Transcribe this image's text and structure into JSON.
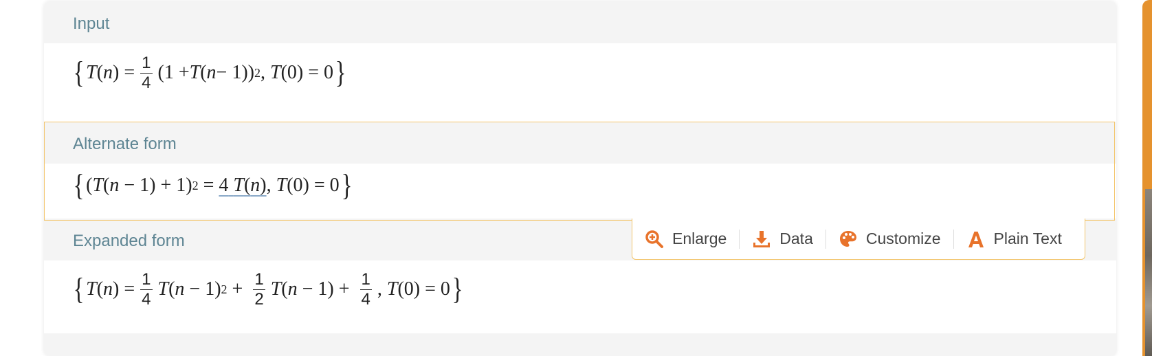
{
  "pods": [
    {
      "title": "Input",
      "math": {
        "lhs1": "T",
        "arg_n": "n",
        "frac_num": "1",
        "frac_den": "4",
        "paren_open": "(1 + ",
        "inner_T": "T",
        "inner_n": "n",
        "minus_one": " − 1))",
        "exp": "2",
        "sep": ", ",
        "T0": "T",
        "zero_arg": "(0) = 0"
      }
    },
    {
      "title": "Alternate form",
      "math": {
        "open": "(",
        "T": "T",
        "n": "n",
        "rest": " − 1) + 1)",
        "exp": "2",
        "eq": " = ",
        "four": "4",
        "T2": "T",
        "n2": "n",
        "sep": ", ",
        "T0": "T",
        "zero_arg": "(0) = 0"
      }
    },
    {
      "title": "Expanded form",
      "math": {
        "T": "T",
        "n": "n",
        "f1_num": "1",
        "f1_den": "4",
        "term1_T": "T",
        "term1_n": "n",
        "term1_rest": " − 1)",
        "exp": "2",
        "plus1": " + ",
        "f2_num": "1",
        "f2_den": "2",
        "term2_T": "T",
        "term2_n": "n",
        "term2_rest": " − 1) + ",
        "f3_num": "1",
        "f3_den": "4",
        "sep": ", ",
        "T0": "T",
        "zero_arg": "(0) = 0"
      }
    }
  ],
  "toolbar": {
    "enlarge": "Enlarge",
    "data": "Data",
    "customize": "Customize",
    "plain_text": "Plain Text"
  },
  "colors": {
    "accent": "#e8732b",
    "pod_title": "#5e8593",
    "highlight_border": "#f3c56b"
  },
  "icons": {
    "enlarge": "zoom-plus-icon",
    "data": "download-icon",
    "customize": "palette-icon",
    "plain_text": "letter-a-icon"
  }
}
